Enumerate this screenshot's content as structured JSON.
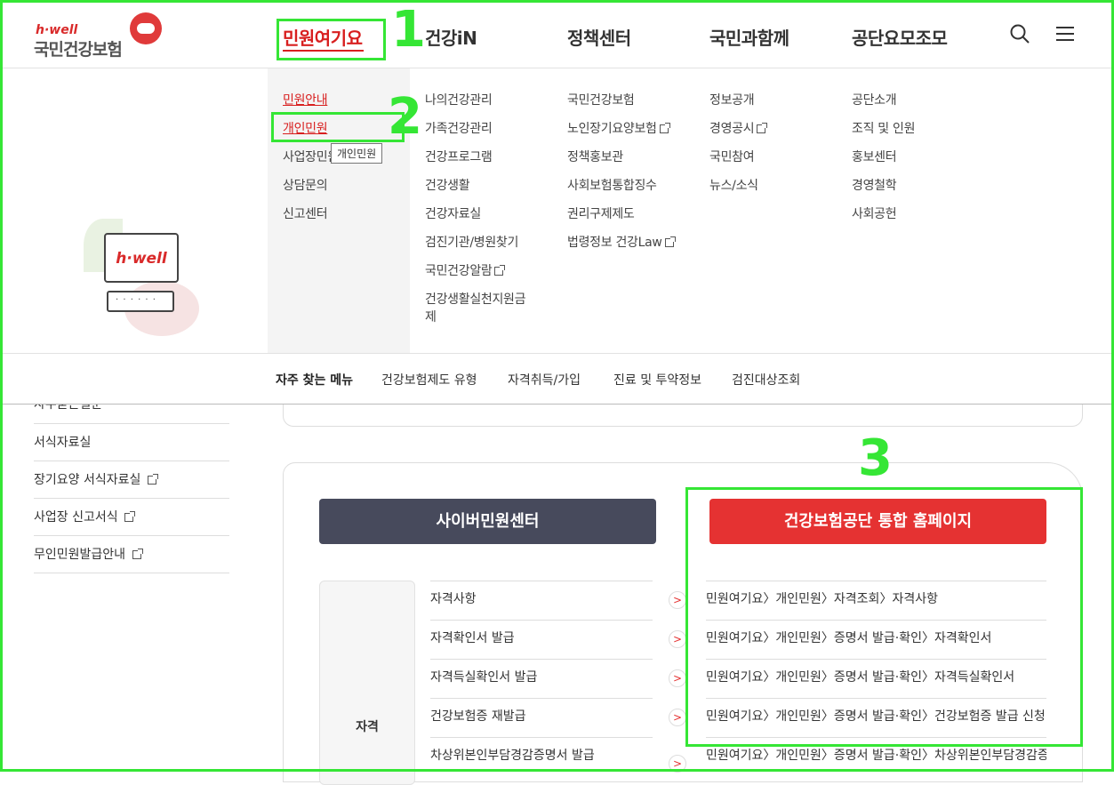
{
  "logo": {
    "en": "h·well",
    "ko": "국민건강보험"
  },
  "gnb": [
    "민원여기요",
    "건강iN",
    "정책센터",
    "국민과함께",
    "공단요모조모"
  ],
  "mega": {
    "col1": [
      {
        "label": "민원안내"
      },
      {
        "label": "개인민원"
      },
      {
        "label": "사업장민원"
      },
      {
        "label": "상담문의"
      },
      {
        "label": "신고센터"
      }
    ],
    "col2": [
      "나의건강관리",
      "가족건강관리",
      "건강프로그램",
      "건강생활",
      "건강자료실",
      "검진기관/병원찾기",
      "국민건강알람",
      "건강생활실천지원금",
      "제"
    ],
    "col3": [
      "국민건강보험",
      "노인장기요양보험",
      "정책홍보관",
      "사회보험통합징수",
      "권리구제제도",
      "법령정보 건강Law"
    ],
    "col4": [
      "정보공개",
      "경영공시",
      "국민참여",
      "뉴스/소식"
    ],
    "col5": [
      "공단소개",
      "조직 및 인원",
      "홍보센터",
      "경영철학",
      "사회공헌"
    ],
    "tooltip": "개인민원",
    "illus_text": "h·well"
  },
  "freq": {
    "title": "자주 찾는 메뉴",
    "items": [
      "건강보험제도 유형",
      "자격취득/가입",
      "진료 및 투약정보",
      "검진대상조회"
    ]
  },
  "lnb": [
    "자주묻는질문",
    "서식자료실",
    "장기요양 서식자료실",
    "사업장 신고서식",
    "무인민원발급안내"
  ],
  "buttons": {
    "cyber": "사이버민원센터",
    "nhis": "건강보험공단 통합 홈페이지"
  },
  "category": "자격",
  "rows": [
    {
      "name": "자격사항",
      "path": "민원여기요〉개인민원〉자격조회〉자격사항"
    },
    {
      "name": "자격확인서 발급",
      "path": "민원여기요〉개인민원〉증명서 발급·확인〉자격확인서"
    },
    {
      "name": "자격득실확인서 발급",
      "path": "민원여기요〉개인민원〉증명서 발급·확인〉자격득실확인서"
    },
    {
      "name": "건강보험증 재발급",
      "path": "민원여기요〉개인민원〉증명서 발급·확인〉건강보험증 발급 신청"
    },
    {
      "name": "차상위본인부담경감증명서 발급",
      "path": "민원여기요〉개인민원〉증명서 발급·확인〉차상위본인부담경감증"
    }
  ],
  "annotations": [
    "1",
    "2",
    "3"
  ],
  "colors": {
    "accent": "#d81f1f",
    "annotation": "#35e635",
    "cyber_btn": "#474a5c",
    "nhis_btn": "#e53232"
  }
}
